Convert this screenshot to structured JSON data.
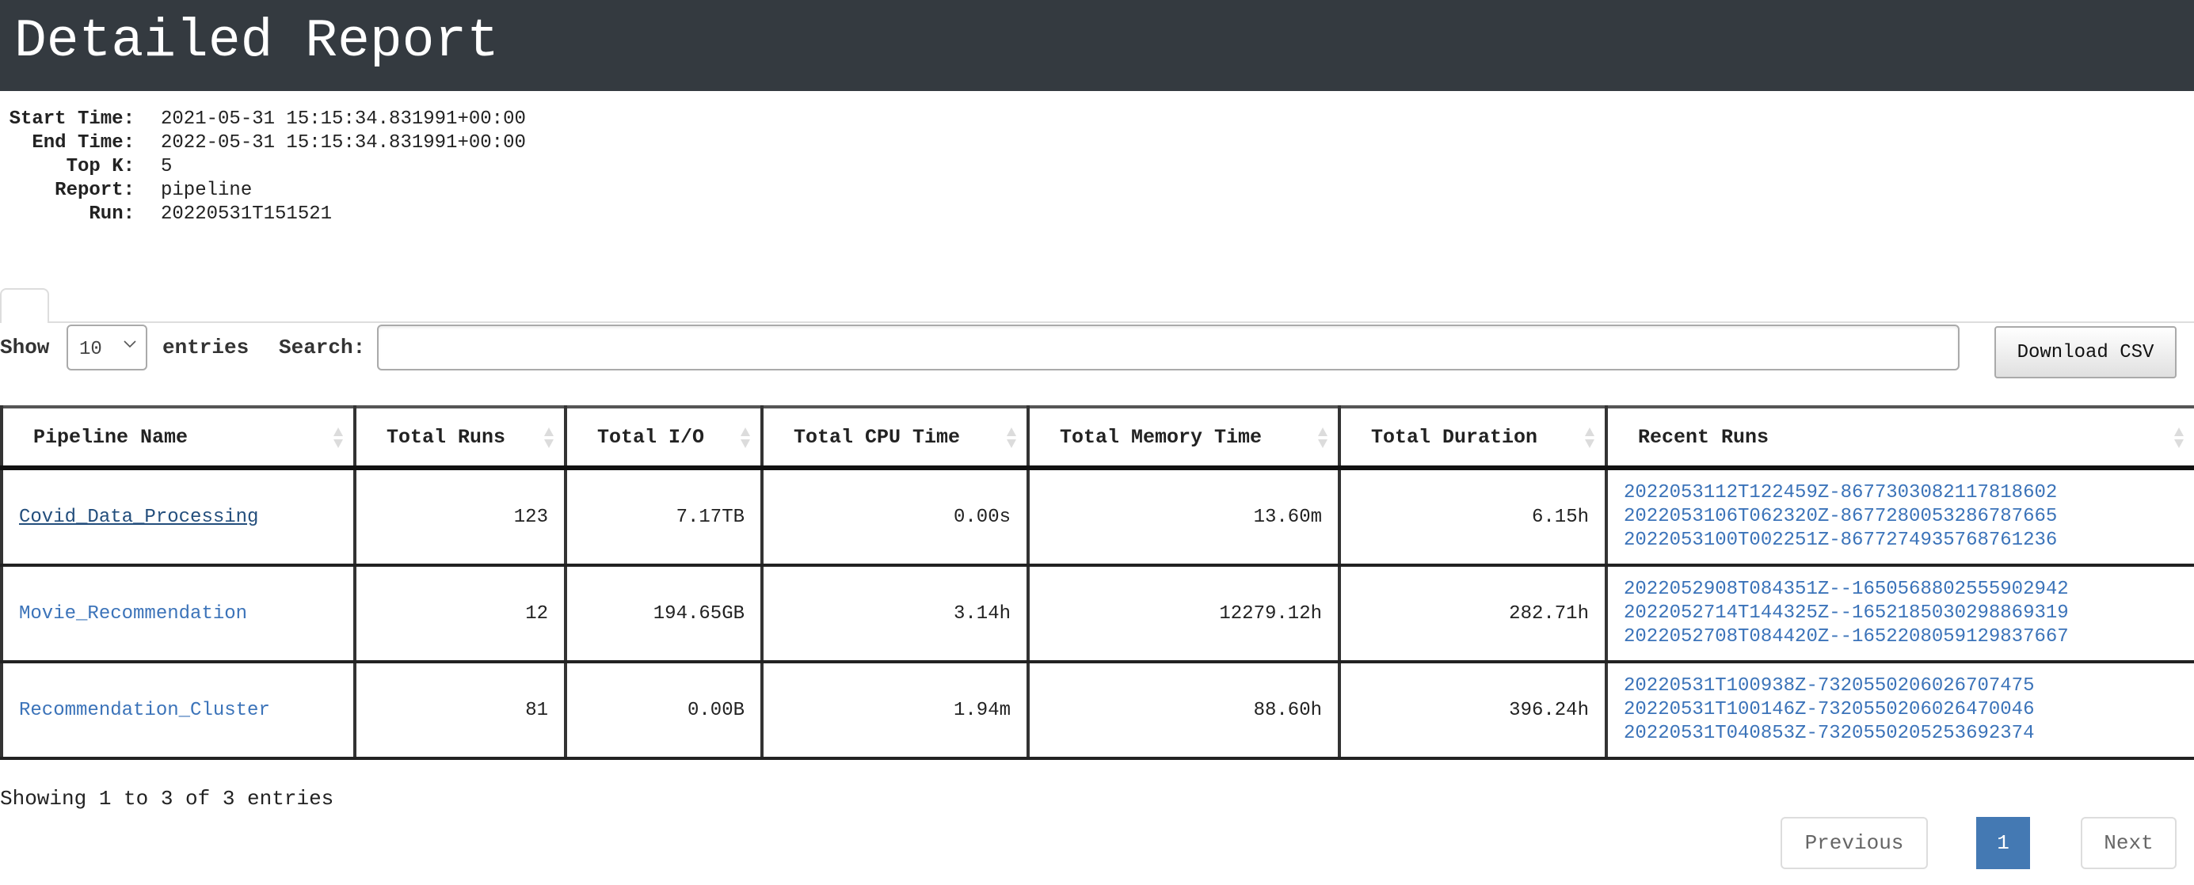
{
  "header": {
    "title": "Detailed Report",
    "background": "#343a40"
  },
  "meta": [
    {
      "label": "Start Time:",
      "value": "2021-05-31 15:15:34.831991+00:00"
    },
    {
      "label": "End Time:",
      "value": "2022-05-31 15:15:34.831991+00:00"
    },
    {
      "label": "Top K:",
      "value": "5"
    },
    {
      "label": "Report:",
      "value": "pipeline"
    },
    {
      "label": "Run:",
      "value": "20220531T151521"
    }
  ],
  "controls": {
    "show_label": "Show",
    "page_size": "10",
    "entries_label": "entries",
    "search_label": "Search:",
    "search_value": "",
    "download_label": "Download CSV"
  },
  "table": {
    "columns": [
      "Pipeline Name",
      "Total Runs",
      "Total I/O",
      "Total CPU Time",
      "Total Memory Time",
      "Total Duration",
      "Recent Runs"
    ],
    "rows": [
      {
        "name": "Covid_Data_Processing",
        "total_runs": "123",
        "total_io": "7.17TB",
        "cpu_time": "0.00s",
        "memory_time": "13.60m",
        "duration": "6.15h",
        "recent_runs": [
          "2022053112T122459Z-8677303082117818602",
          "2022053106T062320Z-8677280053286787665",
          "2022053100T002251Z-8677274935768761236"
        ]
      },
      {
        "name": "Movie_Recommendation",
        "total_runs": "12",
        "total_io": "194.65GB",
        "cpu_time": "3.14h",
        "memory_time": "12279.12h",
        "duration": "282.71h",
        "recent_runs": [
          "2022052908T084351Z--1650568802555902942",
          "2022052714T144325Z--1652185030298869319",
          "2022052708T084420Z--1652208059129837667"
        ]
      },
      {
        "name": "Recommendation_Cluster",
        "total_runs": "81",
        "total_io": "0.00B",
        "cpu_time": "1.94m",
        "memory_time": "88.60h",
        "duration": "396.24h",
        "recent_runs": [
          "20220531T100938Z-7320550206026707475",
          "20220531T100146Z-7320550206026470046",
          "20220531T040853Z-7320550205253692374"
        ]
      }
    ]
  },
  "footer": {
    "info": "Showing 1 to 3 of 3 entries",
    "previous_label": "Previous",
    "current_page": "1",
    "next_label": "Next"
  },
  "colors": {
    "link": "#3b73b9",
    "visited_link": "#234e7c",
    "active_page": "#4479b3"
  }
}
